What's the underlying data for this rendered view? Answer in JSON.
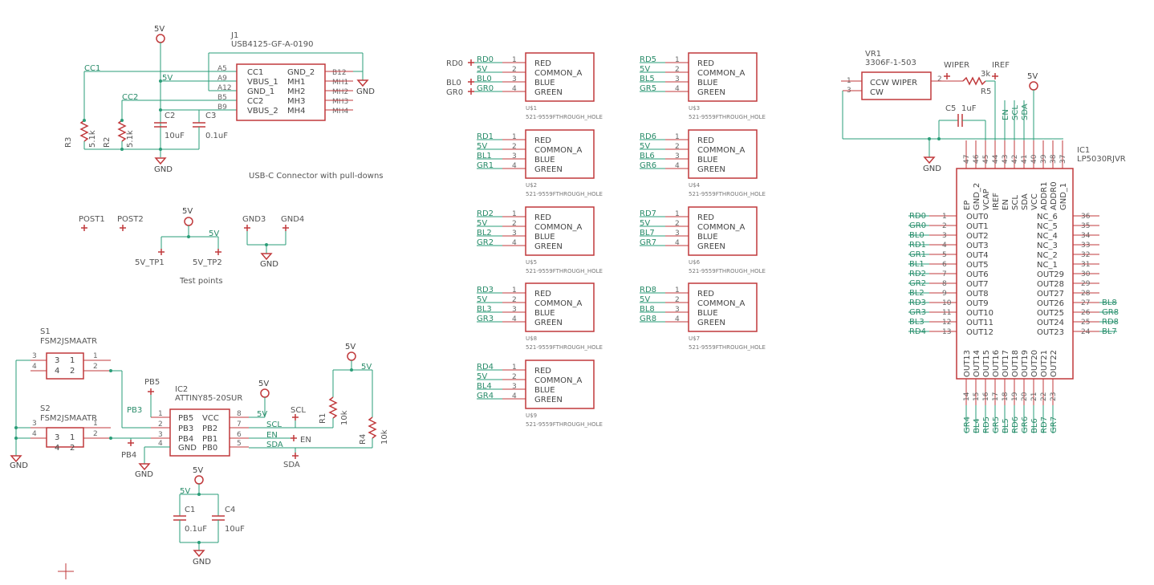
{
  "colors": {
    "wire": "#2a9d78",
    "symbol": "#c0393b",
    "text": "#444444",
    "background": "#ffffff"
  },
  "power_labels": {
    "vcc": "5V",
    "gnd": "GND"
  },
  "usb": {
    "ref": "J1",
    "value": "USB4125-GF-A-0190",
    "left_pins": [
      "CC1",
      "VBUS_1",
      "GND_1",
      "CC2",
      "VBUS_2"
    ],
    "left_nums": [
      "A5",
      "A9",
      "A12",
      "B5",
      "B9"
    ],
    "right_pins": [
      "GND_2",
      "MH1",
      "MH2",
      "MH3",
      "MH4"
    ],
    "right_nums": [
      "B12",
      "MH1",
      "MH2",
      "MH3",
      "MH4"
    ],
    "net_cc1": "CC1",
    "net_cc2": "CC2",
    "r3": {
      "ref": "R3",
      "value": "5.1k"
    },
    "r2": {
      "ref": "R2",
      "value": "5.1k"
    },
    "c2": {
      "ref": "C2",
      "value": "10uF"
    },
    "c3": {
      "ref": "C3",
      "value": "0.1uF"
    },
    "caption": "USB-C Connector with pull-downs"
  },
  "testpoints": {
    "post1": "POST1",
    "post2": "POST2",
    "gnd3": "GND3",
    "gnd4": "GND4",
    "tp1": "5V_TP1",
    "tp2": "5V_TP2",
    "caption": "Test points"
  },
  "switches": {
    "s1": {
      "ref": "S1",
      "value": "FSM2JSMAATR"
    },
    "s2": {
      "ref": "S2",
      "value": "FSM2JSMAATR"
    },
    "pin_labels": {
      "p3": "3",
      "p4": "4",
      "p1": "1",
      "p2": "2"
    }
  },
  "mcu": {
    "ref": "IC2",
    "value": "ATTINY85-20SUR",
    "left_pins": [
      "PB5",
      "PB3",
      "PB4",
      "GND"
    ],
    "left_nums": [
      "1",
      "2",
      "3",
      "4"
    ],
    "right_pins": [
      "VCC",
      "PB2",
      "PB1",
      "PB0"
    ],
    "right_nums": [
      "8",
      "7",
      "6",
      "5"
    ],
    "nets": {
      "pb5": "PB5",
      "pb3": "PB3",
      "pb4": "PB4",
      "scl": "SCL",
      "en": "EN",
      "sda": "SDA"
    },
    "r1": {
      "ref": "R1",
      "value": "10k"
    },
    "r4": {
      "ref": "R4",
      "value": "10k"
    },
    "c1": {
      "ref": "C1",
      "value": "0.1uF"
    },
    "c4": {
      "ref": "C4",
      "value": "10uF"
    }
  },
  "led_pins": [
    "RED",
    "COMMON_A",
    "BLUE",
    "GREEN"
  ],
  "led_part": "521-9559FTHROUGH_HOLE",
  "leds": [
    {
      "ref": "U$1",
      "nets": [
        "RD0",
        "5V",
        "BL0",
        "GR0"
      ]
    },
    {
      "ref": "U$2",
      "nets": [
        "RD1",
        "5V",
        "BL1",
        "GR1"
      ]
    },
    {
      "ref": "U$5",
      "nets": [
        "RD2",
        "5V",
        "BL2",
        "GR2"
      ]
    },
    {
      "ref": "U$8",
      "nets": [
        "RD3",
        "5V",
        "BL3",
        "GR3"
      ]
    },
    {
      "ref": "U$9",
      "nets": [
        "RD4",
        "5V",
        "BL4",
        "GR4"
      ]
    },
    {
      "ref": "U$3",
      "nets": [
        "RD5",
        "5V",
        "BL5",
        "GR5"
      ]
    },
    {
      "ref": "U$4",
      "nets": [
        "RD6",
        "5V",
        "BL6",
        "GR6"
      ]
    },
    {
      "ref": "U$6",
      "nets": [
        "RD7",
        "5V",
        "BL7",
        "GR7"
      ]
    },
    {
      "ref": "U$7",
      "nets": [
        "RD8",
        "5V",
        "BL8",
        "GR8"
      ]
    }
  ],
  "driver": {
    "vr1": {
      "ref": "VR1",
      "value": "3306F-1-503",
      "pin_ccw": "CCW",
      "pin_cw": "CW",
      "pin_wiper": "WIPER"
    },
    "nets": {
      "wiper": "WIPER",
      "iref": "IREF"
    },
    "r5": {
      "ref": "R5",
      "value": "3k"
    },
    "c5": {
      "ref": "C5",
      "value": "1uF"
    },
    "ref": "IC1",
    "value": "LP5030RJVR",
    "top_nums": [
      "47",
      "46",
      "45",
      "44",
      "43",
      "42",
      "41",
      "40",
      "39",
      "38",
      "37"
    ],
    "top_pins": [
      "EP",
      "GND_2",
      "VCAP",
      "IREF",
      "EN",
      "SCL",
      "SDA",
      "VCC",
      "ADDR1",
      "ADDR0",
      "GND_1"
    ],
    "top_nets": [
      "EN",
      "SCL",
      "SDA"
    ],
    "left_nums": [
      "1",
      "2",
      "3",
      "4",
      "5",
      "6",
      "7",
      "8",
      "9",
      "10",
      "11",
      "12",
      "13"
    ],
    "left_pins": [
      "OUT0",
      "OUT1",
      "OUT2",
      "OUT3",
      "OUT4",
      "OUT5",
      "OUT6",
      "OUT7",
      "OUT8",
      "OUT9",
      "OUT10",
      "OUT11",
      "OUT12"
    ],
    "left_nets": [
      "RD0",
      "GR0",
      "BL0",
      "RD1",
      "GR1",
      "BL1",
      "RD2",
      "GR2",
      "BL2",
      "RD3",
      "GR3",
      "BL3",
      "RD4"
    ],
    "right_nums": [
      "36",
      "35",
      "34",
      "33",
      "32",
      "31",
      "30",
      "29",
      "28",
      "27",
      "26",
      "25",
      "24"
    ],
    "right_pins": [
      "NC_6",
      "NC_5",
      "NC_4",
      "NC_3",
      "NC_2",
      "NC_1",
      "OUT29",
      "OUT28",
      "OUT27",
      "OUT26",
      "OUT25",
      "OUT24",
      "OUT23"
    ],
    "right_nets": [
      "BL8",
      "GR8",
      "RD8",
      "BL7"
    ],
    "bottom_nums": [
      "14",
      "15",
      "16",
      "17",
      "18",
      "19",
      "20",
      "21",
      "22",
      "23"
    ],
    "bottom_pins": [
      "OUT13",
      "OUT14",
      "OUT15",
      "OUT16",
      "OUT17",
      "OUT18",
      "OUT19",
      "OUT20",
      "OUT21",
      "OUT22"
    ],
    "bottom_nets": [
      "GR4",
      "BL4",
      "RD5",
      "GR5",
      "BL5",
      "RD6",
      "GR6",
      "BL6",
      "RD7",
      "GR7"
    ]
  }
}
